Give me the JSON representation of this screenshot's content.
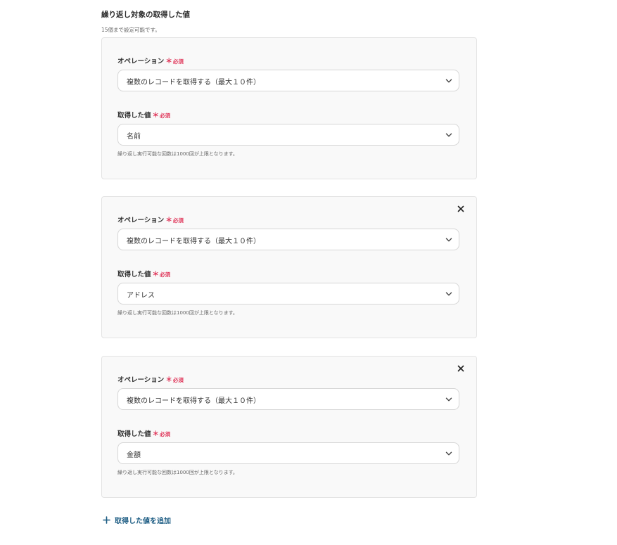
{
  "section": {
    "title": "繰り返し対象の取得した値",
    "note": "15個まで設定可能です。"
  },
  "cards": [
    {
      "operation_label": "オペレーション",
      "operation_required_mark": "＊",
      "operation_required_text": "必須",
      "operation_value": "複数のレコードを取得する（最大１０件）",
      "value_label": "取得した値",
      "value_required_mark": "＊",
      "value_required_text": "必須",
      "value_value": "名前",
      "hint": "繰り返し実行可能な回数は1000回が上限となります。"
    },
    {
      "operation_label": "オペレーション",
      "operation_required_mark": "＊",
      "operation_required_text": "必須",
      "operation_value": "複数のレコードを取得する（最大１０件）",
      "value_label": "取得した値",
      "value_required_mark": "＊",
      "value_required_text": "必須",
      "value_value": "アドレス",
      "hint": "繰り返し実行可能な回数は1000回が上限となります。"
    },
    {
      "operation_label": "オペレーション",
      "operation_required_mark": "＊",
      "operation_required_text": "必須",
      "operation_value": "複数のレコードを取得する（最大１０件）",
      "value_label": "取得した値",
      "value_required_mark": "＊",
      "value_required_text": "必須",
      "value_value": "金額",
      "hint": "繰り返し実行可能な回数は1000回が上限となります。"
    }
  ],
  "add_button": {
    "label": "取得した値を追加"
  },
  "icons": {
    "close": "close-icon",
    "chevron": "chevron-down-icon",
    "plus": "plus-icon"
  },
  "colors": {
    "required": "#e0385b",
    "link": "#1c5c83",
    "card_background": "#f9f9f9",
    "border": "#d6d6d6"
  }
}
